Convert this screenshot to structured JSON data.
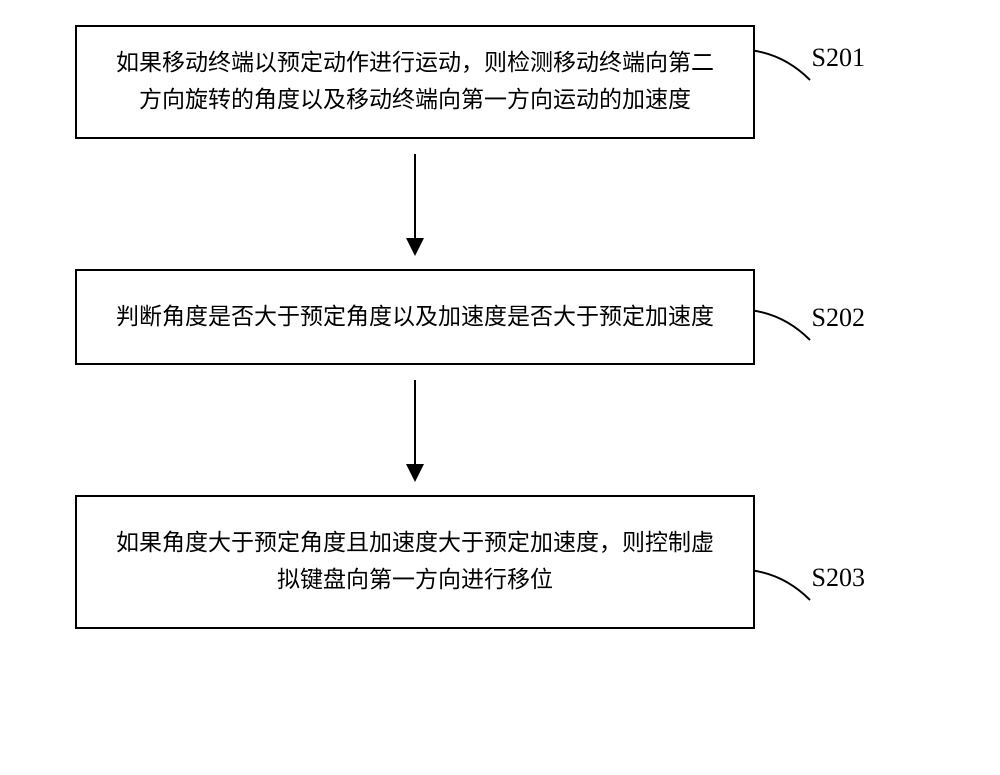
{
  "steps": {
    "s201": {
      "label": "S201",
      "text": "如果移动终端以预定动作进行运动，则检测移动终端向第二方向旋转的角度以及移动终端向第一方向运动的加速度"
    },
    "s202": {
      "label": "S202",
      "text": "判断角度是否大于预定角度以及加速度是否大于预定加速度"
    },
    "s203": {
      "label": "S203",
      "text": "如果角度大于预定角度且加速度大于预定加速度，则控制虚拟键盘向第一方向进行移位"
    }
  }
}
